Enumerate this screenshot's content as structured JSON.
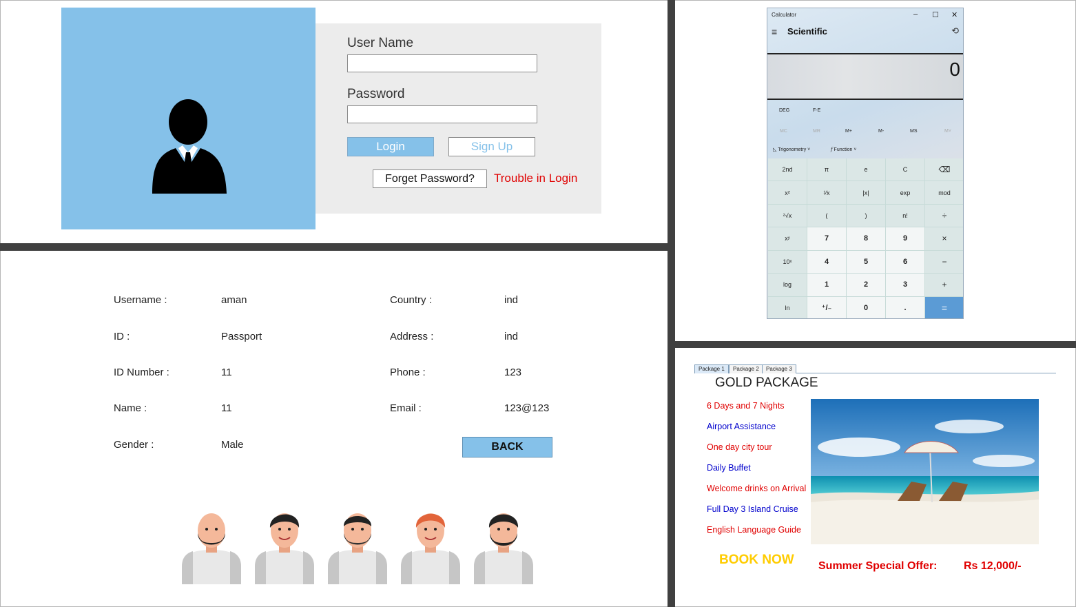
{
  "login": {
    "username_label": "User Name",
    "username_value": "",
    "password_label": "Password",
    "password_value": "",
    "login_button": "Login",
    "signup_button": "Sign Up",
    "forget_button": "Forget Password?",
    "trouble_link": "Trouble in Login",
    "colors": {
      "accent": "#85c1e9",
      "link": "#e00000",
      "panel": "#ececec"
    },
    "photo_icon": "user-silhouette-icon"
  },
  "profile": {
    "fields": [
      {
        "label": "Username :",
        "value": "aman"
      },
      {
        "label": "ID :",
        "value": "Passport"
      },
      {
        "label": "ID Number :",
        "value": "11"
      },
      {
        "label": "Name :",
        "value": "11"
      },
      {
        "label": "Gender :",
        "value": "Male"
      },
      {
        "label": "Country :",
        "value": "ind"
      },
      {
        "label": "Address :",
        "value": "ind"
      },
      {
        "label": "Phone :",
        "value": "123"
      },
      {
        "label": "Email :",
        "value": "123@123"
      }
    ],
    "back_button": "BACK",
    "avatars_icon": "team-avatars-icon"
  },
  "calculator": {
    "window_title": "Calculator",
    "mode": "Scientific",
    "display_value": "0",
    "angle_unit": "DEG",
    "fe_label": "F-E",
    "memory": [
      "MC",
      "MR",
      "M+",
      "M-",
      "MS",
      "M˅"
    ],
    "memory_disabled": [
      true,
      true,
      false,
      false,
      false,
      true
    ],
    "trig_menu": "Trigonometry",
    "func_menu": "Function",
    "keys": [
      "2nd",
      "π",
      "e",
      "C",
      "⌫",
      "x²",
      "¹⁄x",
      "|x|",
      "exp",
      "mod",
      "²√x",
      "(",
      ")",
      "n!",
      "÷",
      "xʸ",
      "7",
      "8",
      "9",
      "×",
      "10ˣ",
      "4",
      "5",
      "6",
      "−",
      "log",
      "1",
      "2",
      "3",
      "+",
      "ln",
      "⁺/₋",
      "0",
      ".",
      "="
    ]
  },
  "package": {
    "tabs": [
      "Package 1",
      "Package 2",
      "Package 3"
    ],
    "active_tab": 0,
    "title": "GOLD PACKAGE",
    "items": [
      {
        "text": "6 Days and 7 Nights",
        "color": "red"
      },
      {
        "text": "Airport Assistance",
        "color": "blue"
      },
      {
        "text": "One day city tour",
        "color": "red"
      },
      {
        "text": "Daily Buffet",
        "color": "blue"
      },
      {
        "text": "Welcome drinks on Arrival",
        "color": "red"
      },
      {
        "text": "Full Day 3 Island Cruise",
        "color": "blue"
      },
      {
        "text": "English Language Guide",
        "color": "red"
      }
    ],
    "book_now": "BOOK NOW",
    "offer_label": "Summer Special Offer:",
    "price": "Rs 12,000/-",
    "image_icon": "beach-photo"
  }
}
